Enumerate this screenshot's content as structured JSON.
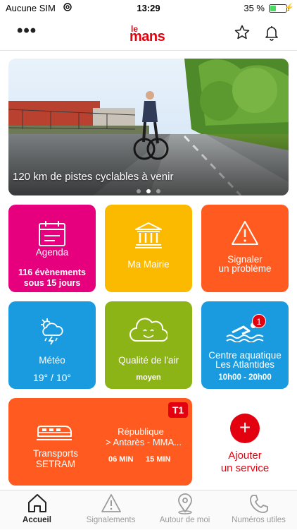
{
  "status_bar": {
    "carrier": "Aucune SIM",
    "time": "13:29",
    "battery_percent": "35 %",
    "battery_level": 0.35
  },
  "header": {
    "logo_small": "le",
    "logo_main": "mans",
    "more_icon": "more-horizontal-icon",
    "star_icon": "star-icon",
    "bell_icon": "bell-icon"
  },
  "hero": {
    "caption": "120 km de pistes cyclables à venir",
    "slides": 3,
    "active_slide": 2
  },
  "tiles": {
    "agenda": {
      "label": "Agenda",
      "sub1": "116 évènements",
      "sub2": "sous 15 jours",
      "color": "#e6007e",
      "icon": "calendar-icon"
    },
    "mairie": {
      "label": "Ma Mairie",
      "color": "#fbb900",
      "icon": "town-hall-icon"
    },
    "signaler": {
      "label1": "Signaler",
      "label2": "un problème",
      "color": "#ff5a1f",
      "icon": "warning-icon"
    },
    "meteo": {
      "label": "Météo",
      "sub": "19° / 10°",
      "color": "#1a9be0",
      "icon": "weather-storm-icon"
    },
    "air": {
      "label": "Qualité de l'air",
      "sub": "moyen",
      "color": "#8db417",
      "icon": "smiling-cloud-icon"
    },
    "aqua": {
      "label1": "Centre aquatique",
      "label2": "Les Atlantides",
      "sub": "10h00 - 20h00",
      "badge": "1",
      "color": "#1a9be0",
      "icon": "swimmer-icon"
    },
    "transports": {
      "label1": "Transports",
      "label2": "SETRAM",
      "line": "T1",
      "stop": "République",
      "direction": "> Antarès - MMA...",
      "time1": "06 MIN",
      "time2": "15 MIN",
      "color": "#ff5a1f",
      "icon": "tram-icon"
    }
  },
  "add_service": {
    "label1": "Ajouter",
    "label2": "un service",
    "color": "#e3000f"
  },
  "tab_bar": {
    "tabs": [
      {
        "label": "Accueil",
        "icon": "home-icon",
        "active": true
      },
      {
        "label": "Signalements",
        "icon": "warning-icon",
        "active": false
      },
      {
        "label": "Autour de moi",
        "icon": "location-pin-icon",
        "active": false
      },
      {
        "label": "Numéros utiles",
        "icon": "phone-icon",
        "active": false
      }
    ]
  }
}
